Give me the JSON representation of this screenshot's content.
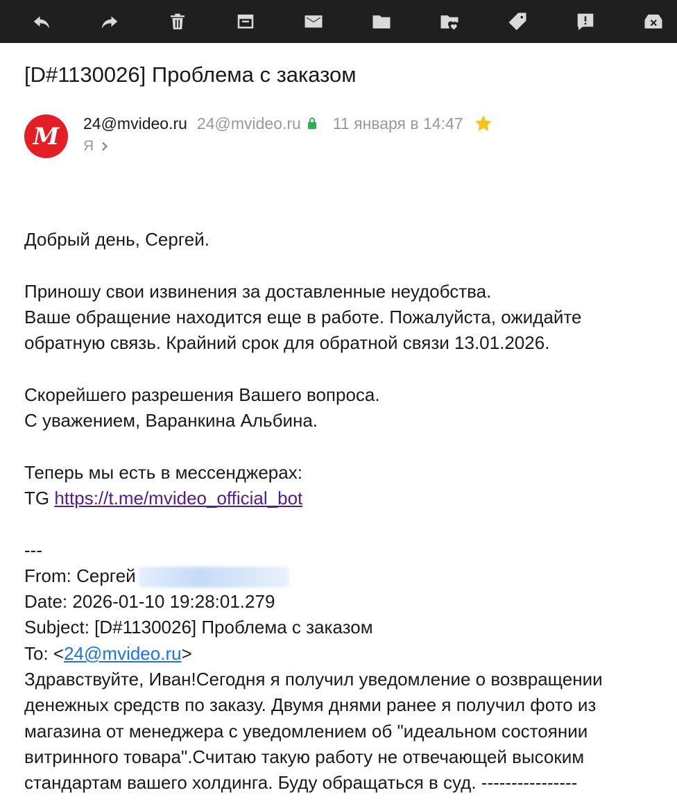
{
  "toolbar": {
    "icons": [
      "reply-icon",
      "forward-icon",
      "delete-icon",
      "archive-icon",
      "mark-unread-icon",
      "move-to-folder-icon",
      "folder-heart-icon",
      "label-icon",
      "snooze-icon",
      "spam-icon"
    ]
  },
  "message": {
    "subject": "[D#1130026] Проблема с заказом",
    "sender_name": "24@mvideo.ru",
    "sender_email": "24@mvideo.ru",
    "date": "11 января в 14:47",
    "recipient": "Я",
    "avatar_letter": "М",
    "colors": {
      "avatar": "#e31e24",
      "lock": "#2bb24c",
      "star": "#f5c518"
    }
  },
  "body": {
    "greeting": "Добрый день, Сергей.",
    "apology": "Приношу свои извинения за доставленные неудобства.",
    "status_line1": "Ваше обращение находится еще в работе. Пожалуйста, ожидайте",
    "status_line2": "обратную связь. Крайний срок для обратной связи 13.01.2026.",
    "wish": "Скорейшего разрешения Вашего вопроса.",
    "signature": "С уважением, Варанкина Альбина.",
    "messengers": "Теперь мы есть в мессенджерах:",
    "tg_prefix": "TG",
    "tg_link": "https://t.me/mvideo_official_bot",
    "separator": "---",
    "from_label": "From: Сергей",
    "date_line": "Date: 2026-01-10 19:28:01.279",
    "subject_line": "Subject: [D#1130026] Проблема с заказом",
    "to_prefix": "To: <",
    "to_link": "24@mvideo.ru",
    "to_suffix": ">",
    "quote_lines": [
      "Здравствуйте, Иван!Сегодня я получил уведомление о возвращении",
      "денежных средств по заказу. Двумя днями ранее я получил фото из",
      "магазина от менеджера с уведомлением об \"идеальном состоянии",
      "витринного товара\".Считаю такую работу не отвечающей высоким",
      "стандартам вашего холдинга. Буду обращаться в суд. ----------------"
    ]
  }
}
